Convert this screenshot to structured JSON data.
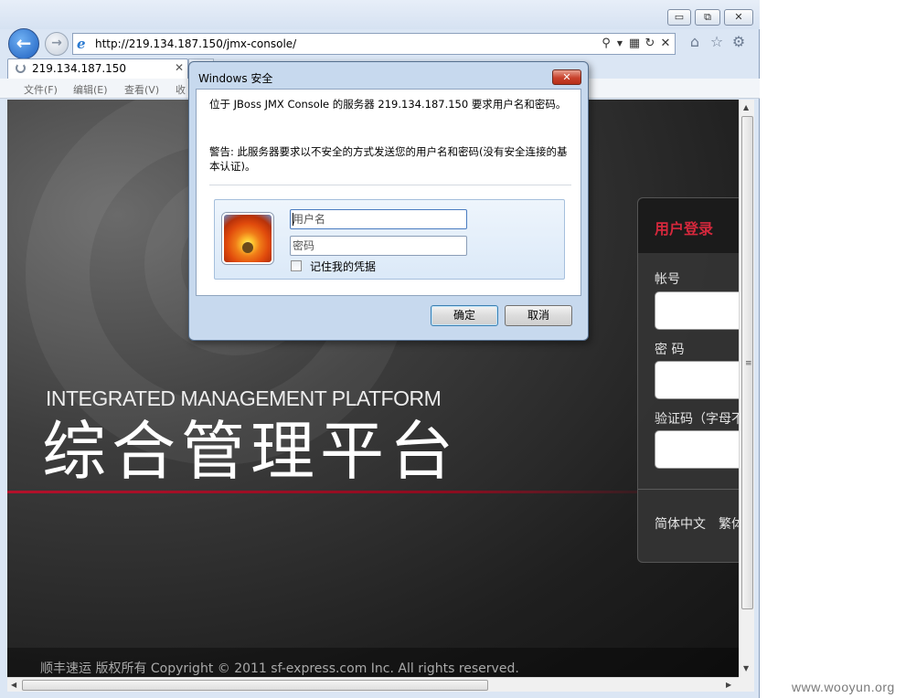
{
  "browser": {
    "url": "http://219.134.187.150/jmx-console/",
    "tab_title": "219.134.187.150",
    "window_controls": {
      "minimize": "▭",
      "restore": "⧉",
      "close": "✕"
    },
    "menu": [
      "文件(F)",
      "编辑(E)",
      "查看(V)",
      "收"
    ]
  },
  "page": {
    "platform_en": "INTEGRATED MANAGEMENT PLATFORM",
    "platform_cn": "综合管理平台",
    "copyright": "顺丰速运 版权所有 Copyright © 2011 sf-express.com Inc. All rights reserved.",
    "login": {
      "title": "用户登录",
      "account_label": "帐号",
      "password_label": "密 码",
      "captcha_label": "验证码（字母不",
      "lang_simplified": "简体中文",
      "lang_traditional": "繁体"
    }
  },
  "dialog": {
    "title": "Windows 安全",
    "message": "位于 JBoss JMX Console 的服务器 219.134.187.150 要求用户名和密码。",
    "warning": "警告: 此服务器要求以不安全的方式发送您的用户名和密码(没有安全连接的基本认证)。",
    "username_placeholder": "用户名",
    "password_placeholder": "密码",
    "remember_label": "记住我的凭据",
    "ok_label": "确定",
    "cancel_label": "取消"
  },
  "watermark": "www.wooyun.org",
  "colors": {
    "accent_red": "#c8102e",
    "dialog_frame": "#c7d9ee",
    "page_dark": "#1f1f1f"
  }
}
